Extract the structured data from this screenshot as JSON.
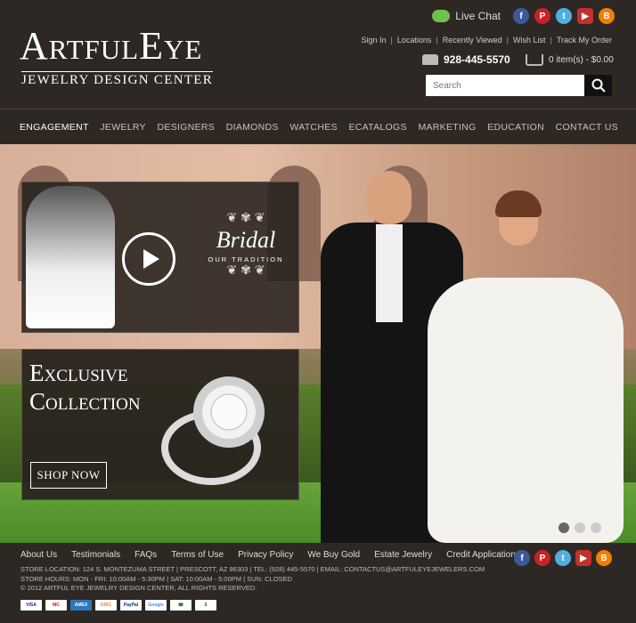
{
  "header": {
    "logo_main": "ArtfulEye",
    "logo_sub": "JEWELRY DESIGN CENTER",
    "live_chat": "Live Chat",
    "social": [
      "facebook-icon",
      "pinterest-icon",
      "twitter-icon",
      "youtube-icon",
      "blogger-icon"
    ],
    "links": [
      "Sign In",
      "Locations",
      "Recently Viewed",
      "Wish List",
      "Track My Order"
    ],
    "phone": "928-445-5570",
    "cart": "0 item(s) - $0.00",
    "search_placeholder": "Search"
  },
  "nav": [
    {
      "label": "ENGAGEMENT",
      "active": true
    },
    {
      "label": "JEWELRY"
    },
    {
      "label": "DESIGNERS"
    },
    {
      "label": "DIAMONDS"
    },
    {
      "label": "WATCHES"
    },
    {
      "label": "ECATALOGS"
    },
    {
      "label": "MARKETING"
    },
    {
      "label": "EDUCATION"
    },
    {
      "label": "CONTACT US"
    }
  ],
  "hero": {
    "bridal_title": "Bridal",
    "bridal_sub": "OUR TRADITION",
    "collection_line1": "Exclusive",
    "collection_line2": "Collection",
    "shop_now": "SHOP NOW",
    "slides_total": 3,
    "active_slide": 1
  },
  "footer": {
    "links": [
      "About Us",
      "Testimonials",
      "FAQs",
      "Terms of Use",
      "Privacy Policy",
      "We Buy Gold",
      "Estate Jewelry",
      "Credit Application"
    ],
    "info_line1": "STORE LOCATION: 124 S. MONTEZUMA STREET | PRESCOTT,  AZ  86303 | TEL: (928) 445-5570 | EMAIL: CONTACTUS@ARTFULEYEJEWELERS.COM",
    "info_line2": "STORE HOURS: MON - FRI: 10:00AM - 5:30PM | SAT: 10:00AM - 5:00PM | SUN: CLOSED",
    "info_line3": "© 2012 ARTFUL EYE JEWELRY DESIGN CENTER, ALL RIGHTS RESERVED.",
    "payments": [
      "VISA",
      "MasterCard",
      "AmEx",
      "DISCOVER",
      "PayPal",
      "Google",
      "Order by Phone",
      "Financing"
    ]
  },
  "colors": {
    "background": "#2e2824",
    "text": "#ffffff",
    "nav_text": "#c8c0b8"
  }
}
